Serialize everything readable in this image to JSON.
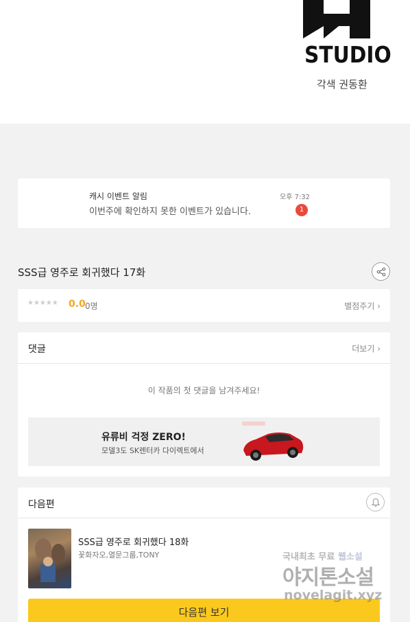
{
  "header": {
    "studio_name": "STUDIO",
    "artist_credit": "각색 권동환"
  },
  "notification": {
    "title": "캐시 이벤트 알림",
    "body": "이번주에 확인하지 못한 이벤트가 있습니다.",
    "time": "오후 7:32",
    "badge_count": "1"
  },
  "episode": {
    "title": "SSS급 영주로 회귀했다 17화",
    "share_icon": "share-icon"
  },
  "rating": {
    "stars": "★★★★★",
    "score": "0.0",
    "count": "0명",
    "rate_link": "별점주기 ›"
  },
  "comments": {
    "title": "댓글",
    "more_link": "더보기 ›",
    "empty_message": "이 작품의 첫 댓글을 남겨주세요!"
  },
  "ad": {
    "title": "유류비 걱정 ZERO!",
    "subtitle": "모델3도 SK렌터카 다이렉트에서"
  },
  "next_episode": {
    "section_title": "다음편",
    "title": "SSS급 영주로 회귀했다 18화",
    "authors": "꽃화자오,열문그룹,TONY",
    "button_label": "다음편 보기"
  },
  "watermark": {
    "line1_a": "국내최초 무료 ",
    "line1_b": "웹소설",
    "line2": "야지톤소설",
    "line3": "novelagit.xyz"
  },
  "colors": {
    "accent_yellow": "#fbc91d",
    "score_orange": "#f5a623",
    "badge_red": "#e94a3e"
  }
}
